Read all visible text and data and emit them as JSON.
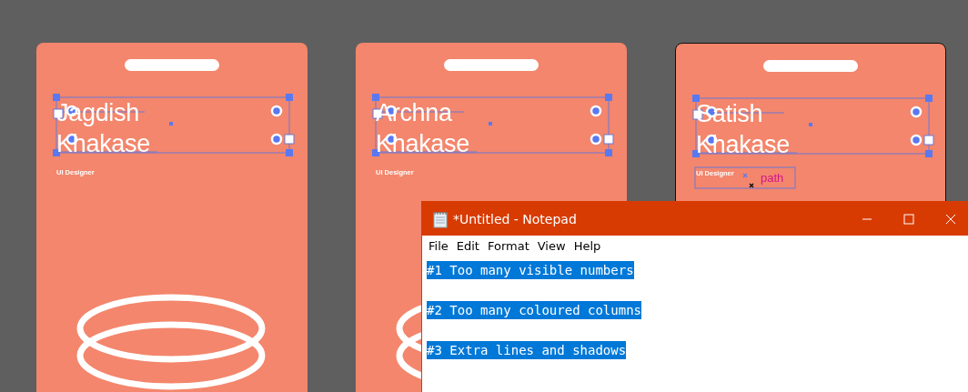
{
  "cards": [
    {
      "name_lines": [
        "Jagdish",
        "Khakase"
      ],
      "role": "UI Designer",
      "selected": false,
      "rings": true
    },
    {
      "name_lines": [
        "Archna",
        "Khakase"
      ],
      "role": "UI Designer",
      "selected": false,
      "rings": true
    },
    {
      "name_lines": [
        "Satish",
        "Khakase"
      ],
      "role": "UI Designer",
      "selected": true,
      "path_label": "path"
    }
  ],
  "notepad": {
    "title": "*Untitled - Notepad",
    "menu": [
      "File",
      "Edit",
      "Format",
      "View",
      "Help"
    ],
    "lines": [
      {
        "text": "#1 Too many visible numbers",
        "selected": true
      },
      {
        "text": "#2 Too many coloured columns",
        "selected": true
      },
      {
        "text": "#3 Extra lines and shadows",
        "selected": true
      }
    ]
  }
}
